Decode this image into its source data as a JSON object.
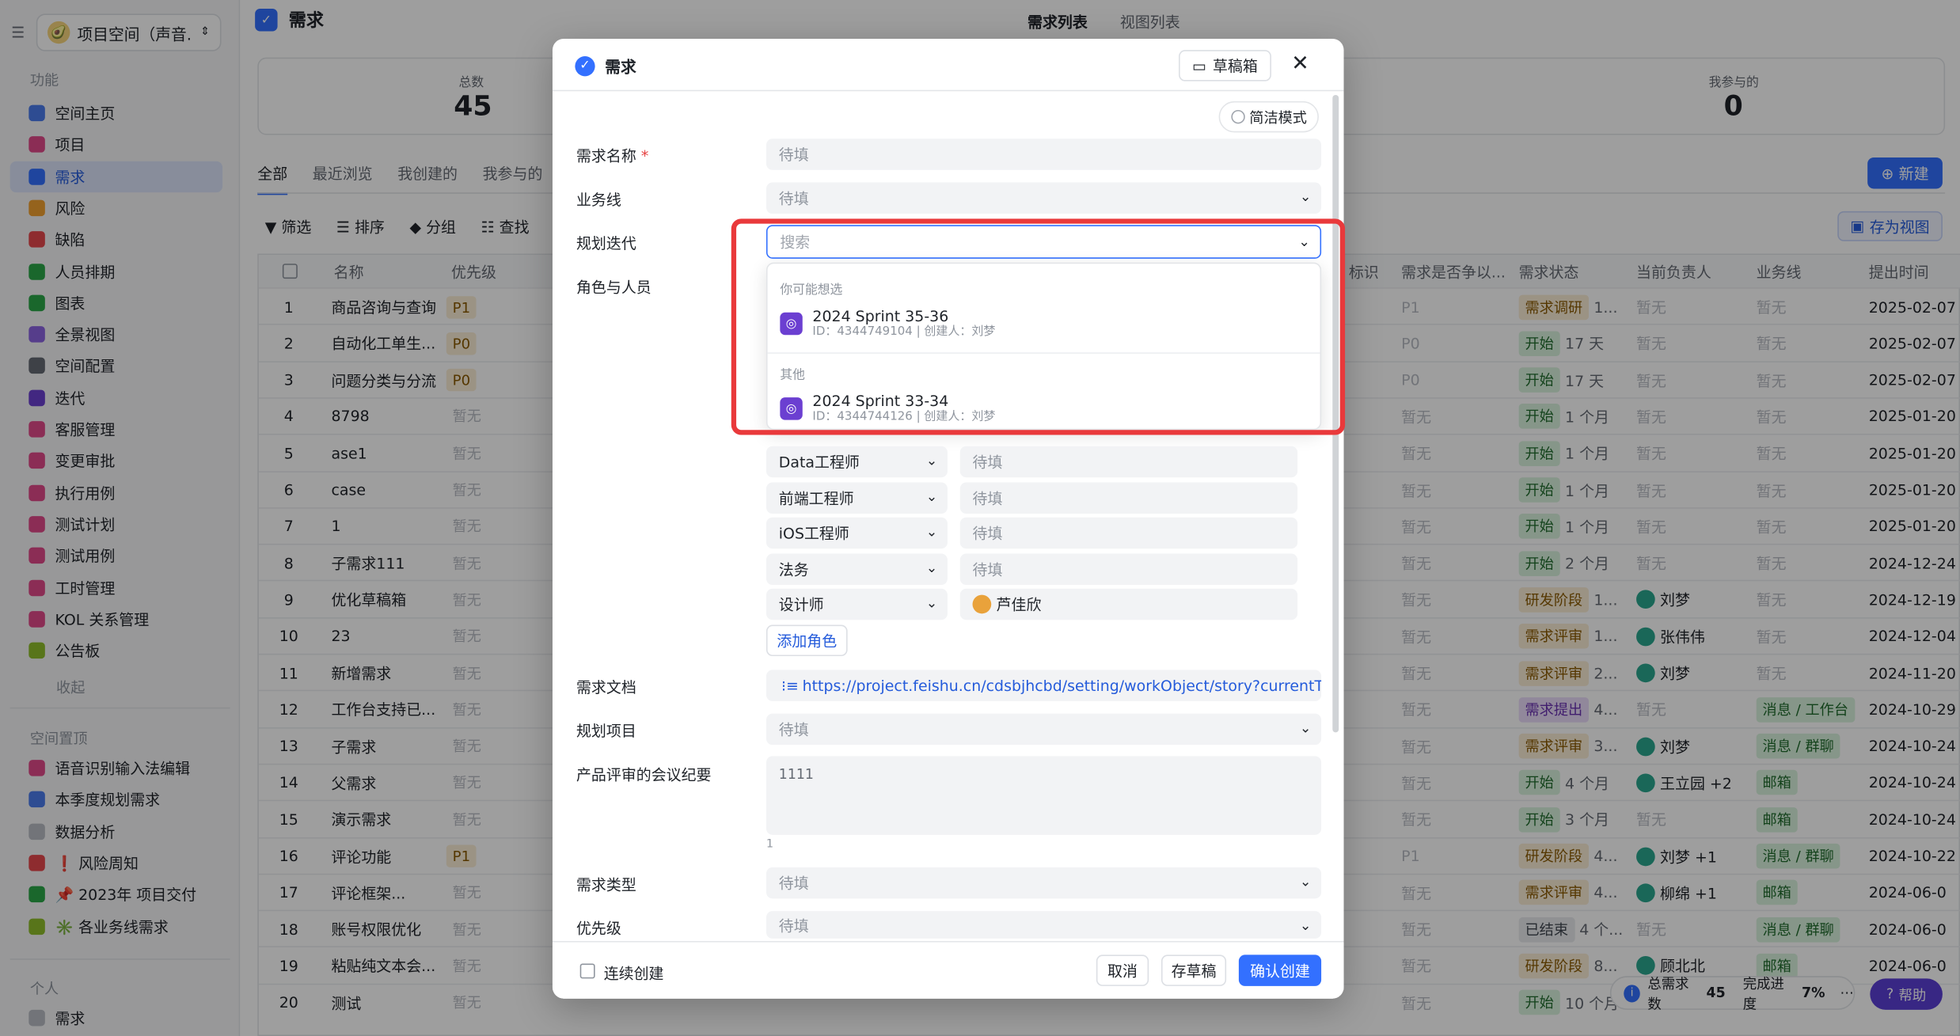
{
  "sidebar": {
    "workspace": "项目空间（声音...",
    "section_features": "功能",
    "items": [
      {
        "label": "空间主页",
        "color": "#4b7bec"
      },
      {
        "label": "项目",
        "color": "#e04a8a"
      },
      {
        "label": "需求",
        "color": "#3370ff",
        "active": true
      },
      {
        "label": "风险",
        "color": "#f0a030"
      },
      {
        "label": "缺陷",
        "color": "#e5484d"
      },
      {
        "label": "人员排期",
        "color": "#2aa648"
      },
      {
        "label": "图表",
        "color": "#2aa648"
      },
      {
        "label": "全景视图",
        "color": "#8b63e0"
      },
      {
        "label": "空间配置",
        "color": "#646a73"
      },
      {
        "label": "迭代",
        "color": "#6b3fd1"
      },
      {
        "label": "客服管理",
        "color": "#e04a8a"
      },
      {
        "label": "变更审批",
        "color": "#e04a8a"
      },
      {
        "label": "执行用例",
        "color": "#e04a8a"
      },
      {
        "label": "测试计划",
        "color": "#e04a8a"
      },
      {
        "label": "测试用例",
        "color": "#e04a8a"
      },
      {
        "label": "工时管理",
        "color": "#e04a8a"
      },
      {
        "label": "KOL 关系管理",
        "color": "#e04a8a"
      },
      {
        "label": "公告板",
        "color": "#8fbd2a"
      }
    ],
    "collapse": "收起",
    "section_pinned": "空间置顶",
    "pinned": [
      {
        "label": "语音识别输入法编辑",
        "color": "#e04a8a"
      },
      {
        "label": "本季度规划需求",
        "color": "#4b7bec"
      },
      {
        "label": "数据分析",
        "color": "#b8bcc3"
      },
      {
        "label": "❗ 风险周知",
        "color": "#e5484d"
      },
      {
        "label": "📌 2023年 项目交付",
        "color": "#2aa648"
      },
      {
        "label": "✳️ 各业务线需求",
        "color": "#8fbd2a"
      }
    ],
    "section_personal": "个人",
    "personal": [
      {
        "label": "需求",
        "color": "#b8bcc3"
      }
    ]
  },
  "header": {
    "title": "需求",
    "tab_list": "需求列表",
    "tab_view": "视图列表"
  },
  "stats": {
    "total_label": "总数",
    "total_value": "45",
    "mine_label": "我参与的",
    "mine_value": "0"
  },
  "tabs": [
    "全部",
    "最近浏览",
    "我创建的",
    "我参与的"
  ],
  "new_button": "新建",
  "toolbar": {
    "filter": "筛选",
    "sort": "排序",
    "group": "分组",
    "search": "查找",
    "save_view": "存为视图"
  },
  "table": {
    "columns_left": [
      "名称",
      "优先级"
    ],
    "columns_right": [
      "标识",
      "需求是否争以...",
      "需求状态",
      "当前负责人",
      "业务线",
      "提出时间"
    ],
    "rows": [
      {
        "n": "1",
        "name": "商品咨询与查询",
        "pri": "P1",
        "status": "需求调研",
        "dur": "1...",
        "owner": "暂无",
        "biz": "暂无",
        "date": "2025-02-07"
      },
      {
        "n": "2",
        "name": "自动化工单生...",
        "pri": "P0",
        "status": "开始",
        "dur": "17 天",
        "owner": "暂无",
        "biz": "暂无",
        "date": "2025-02-07"
      },
      {
        "n": "3",
        "name": "问题分类与分流",
        "pri": "P0",
        "status": "开始",
        "dur": "17 天",
        "owner": "暂无",
        "biz": "暂无",
        "date": "2025-02-07"
      },
      {
        "n": "4",
        "name": "8798",
        "pri": "暂无",
        "status": "开始",
        "dur": "1 个月",
        "owner": "暂无",
        "biz": "暂无",
        "date": "2025-01-20"
      },
      {
        "n": "5",
        "name": "ase1",
        "pri": "暂无",
        "status": "开始",
        "dur": "1 个月",
        "owner": "暂无",
        "biz": "暂无",
        "date": "2025-01-20"
      },
      {
        "n": "6",
        "name": "case",
        "pri": "暂无",
        "status": "开始",
        "dur": "1 个月",
        "owner": "暂无",
        "biz": "暂无",
        "date": "2025-01-20"
      },
      {
        "n": "7",
        "name": "1",
        "pri": "暂无",
        "status": "开始",
        "dur": "1 个月",
        "owner": "暂无",
        "biz": "暂无",
        "date": "2025-01-20"
      },
      {
        "n": "8",
        "name": "子需求111",
        "pri": "暂无",
        "status": "开始",
        "dur": "2 个月",
        "owner": "暂无",
        "biz": "暂无",
        "date": "2024-12-24"
      },
      {
        "n": "9",
        "name": "优化草稿箱",
        "pri": "暂无",
        "status": "研发阶段",
        "dur": "1...",
        "owner": "刘梦",
        "biz": "暂无",
        "date": "2024-12-19"
      },
      {
        "n": "10",
        "name": "23",
        "pri": "暂无",
        "status": "需求评审",
        "dur": "1...",
        "owner": "张伟伟",
        "biz": "暂无",
        "date": "2024-12-04"
      },
      {
        "n": "11",
        "name": "新增需求",
        "pri": "暂无",
        "status": "需求评审",
        "dur": "2...",
        "owner": "刘梦",
        "biz": "暂无",
        "date": "2024-11-20"
      },
      {
        "n": "12",
        "name": "工作台支持已...",
        "pri": "暂无",
        "status": "需求提出",
        "dur": "4...",
        "owner": "暂无",
        "biz": "消息 / 工作台",
        "date": "2024-10-29"
      },
      {
        "n": "13",
        "name": "子需求",
        "pri": "暂无",
        "status": "需求评审",
        "dur": "3...",
        "owner": "刘梦",
        "biz": "消息 / 群聊",
        "date": "2024-10-24"
      },
      {
        "n": "14",
        "name": "父需求",
        "pri": "暂无",
        "status": "开始",
        "dur": "4 个月",
        "owner": "王立园 +2",
        "biz": "邮箱",
        "date": "2024-10-24"
      },
      {
        "n": "15",
        "name": "演示需求",
        "pri": "暂无",
        "status": "开始",
        "dur": "3 个月",
        "owner": "暂无",
        "biz": "邮箱",
        "date": "2024-10-24"
      },
      {
        "n": "16",
        "name": "评论功能",
        "pri": "P1",
        "status": "研发阶段",
        "dur": "4...",
        "owner": "刘梦 +1",
        "biz": "消息 / 群聊",
        "date": "2024-10-22"
      },
      {
        "n": "17",
        "name": "评论框架...",
        "pri": "暂无",
        "status": "需求评审",
        "dur": "4...",
        "owner": "柳绵 +1",
        "biz": "邮箱",
        "date": "2024-06-0"
      },
      {
        "n": "18",
        "name": "账号权限优化",
        "pri": "暂无",
        "status": "已结束",
        "dur": "4 个...",
        "owner": "暂无",
        "biz": "消息 / 群聊",
        "date": "2024-06-0"
      },
      {
        "n": "19",
        "name": "粘贴纯文本会...",
        "pri": "暂无",
        "status": "研发阶段",
        "dur": "8...",
        "owner": "顾北北",
        "biz": "邮箱",
        "date": "2024-06-0"
      },
      {
        "n": "20",
        "name": "测试",
        "pri": "暂无",
        "status": "开始",
        "dur": "10 个月",
        "owner": "",
        "biz": "",
        "date": ""
      }
    ]
  },
  "footer_stats": {
    "total_label": "总需求数",
    "total": "45",
    "progress_label": "完成进度",
    "progress": "7%",
    "help": "帮助"
  },
  "modal": {
    "title": "需求",
    "draft_box": "草稿箱",
    "simple_mode": "简洁模式",
    "fields": {
      "name_label": "需求名称",
      "name_placeholder": "待填",
      "biz_label": "业务线",
      "biz_placeholder": "待填",
      "iter_label": "规划迭代",
      "iter_placeholder": "搜索",
      "roles_label": "角色与人员"
    },
    "dropdown": {
      "suggest_label": "你可能想选",
      "other_label": "其他",
      "items": [
        {
          "name": "2024 Sprint 35-36",
          "meta": "ID：4344749104 | 创建人：刘梦"
        },
        {
          "name": "2024 Sprint 33-34",
          "meta": "ID：4344744126 | 创建人：刘梦"
        }
      ]
    },
    "roles": [
      {
        "role": "Data工程师",
        "value": "待填"
      },
      {
        "role": "前端工程师",
        "value": "待填"
      },
      {
        "role": "iOS工程师",
        "value": "待填"
      },
      {
        "role": "法务",
        "value": "待填"
      },
      {
        "role": "设计师",
        "value": "芦佳欣"
      }
    ],
    "add_role": "添加角色",
    "doc_label": "需求文档",
    "doc_link": "https://project.feishu.cn/cdsbjhcbd/setting/workObject/story?currentT...",
    "project_label": "规划项目",
    "project_placeholder": "待填",
    "minutes_label": "产品评审的会议纪要",
    "minutes_value": "1111",
    "minutes_count": "1",
    "type_label": "需求类型",
    "type_placeholder": "待填",
    "priority_label": "优先级",
    "priority_placeholder": "待填",
    "continuous": "连续创建",
    "cancel": "取消",
    "save_draft": "存草稿",
    "confirm": "确认创建"
  },
  "colors": {
    "accent": "#3370ff",
    "highlight": "#e9393b"
  }
}
